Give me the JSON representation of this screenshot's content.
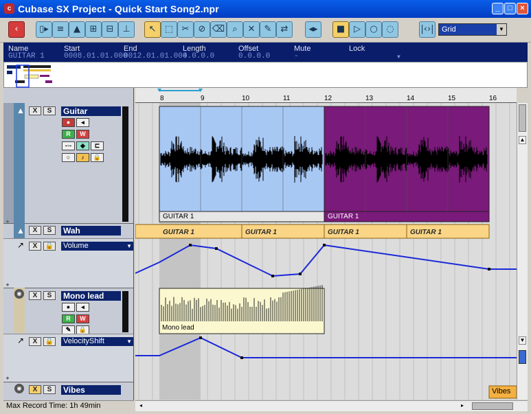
{
  "window": {
    "title": "Cubase SX Project - Quick Start Song2.npr",
    "buttons": {
      "minimize": "_",
      "maximize": "□",
      "close": "×"
    }
  },
  "toolbar": {
    "tools": [
      {
        "name": "back-button",
        "glyph": "‹",
        "style": "red"
      },
      {
        "name": "inspector-button",
        "glyph": "▯▸"
      },
      {
        "name": "lanes-button",
        "glyph": "≡"
      },
      {
        "name": "lanes-down-button",
        "glyph": "▲"
      },
      {
        "name": "pool-button",
        "glyph": "⊞"
      },
      {
        "name": "mixer-button",
        "glyph": "⊟"
      },
      {
        "name": "channel-button",
        "glyph": "⊥"
      },
      {
        "name": "pointer-tool",
        "glyph": "↖",
        "style": "sel"
      },
      {
        "name": "range-tool",
        "glyph": "⬚"
      },
      {
        "name": "split-tool",
        "glyph": "✂"
      },
      {
        "name": "glue-tool",
        "glyph": "⊘"
      },
      {
        "name": "erase-tool",
        "glyph": "⌫"
      },
      {
        "name": "zoom-tool",
        "glyph": "⌕"
      },
      {
        "name": "mute-tool",
        "glyph": "✕"
      },
      {
        "name": "draw-tool",
        "glyph": "✎"
      },
      {
        "name": "time-tool",
        "glyph": "⇄"
      },
      {
        "name": "nudge-button",
        "glyph": "◂▸"
      },
      {
        "name": "stop-button",
        "glyph": "■",
        "style": "sel"
      },
      {
        "name": "play-button",
        "glyph": "▷"
      },
      {
        "name": "record-button",
        "glyph": "○"
      },
      {
        "name": "cycle-button",
        "glyph": "◌"
      },
      {
        "name": "snap-button",
        "glyph": "|‹›|"
      }
    ],
    "grid_value": "Grid",
    "grid_arrow": "▼"
  },
  "info": {
    "headers": [
      "Name",
      "Start",
      "End",
      "Length",
      "Offset",
      "Mute",
      "Lock"
    ],
    "values": [
      "GUITAR 1",
      "0008.01.01.000",
      "0012.01.01.000",
      "4.0.0.0",
      "0.0.0.0",
      "-",
      "▼"
    ]
  },
  "ruler": {
    "marks": [
      "8",
      "9",
      "10",
      "11",
      "12",
      "13",
      "14",
      "15",
      "16"
    ]
  },
  "tracks": {
    "guitar": {
      "name": "Guitar",
      "m": "X",
      "s": "S",
      "r": "R",
      "w": "W"
    },
    "wah": {
      "name": "Wah",
      "m": "X",
      "s": "S",
      "param": "Volume",
      "dd": "▼"
    },
    "mono": {
      "name": "Mono lead",
      "m": "X",
      "s": "S",
      "r": "R",
      "w": "W",
      "param": "VelocityShift",
      "dd": "▼"
    },
    "vibes": {
      "name": "Vibes",
      "m": "X",
      "s": "S"
    }
  },
  "events": {
    "guitar1_left": "GUITAR 1",
    "guitar1_right": "GUITAR 1",
    "wah_parts": [
      "GUITAR 1",
      "GUITAR 1",
      "GUITAR 1",
      "GUITAR 1"
    ],
    "mono_lead": "Mono lead",
    "vibes": "Vibes"
  },
  "colors": {
    "guitar_left": "#a8c8f4",
    "guitar_right": "#7a1a7a",
    "wah_part": "#fbd586",
    "mono_part": "#fbf8d0",
    "automation": "#1a28d8"
  },
  "status": {
    "text": "Max Record Time: 1h 49min"
  }
}
